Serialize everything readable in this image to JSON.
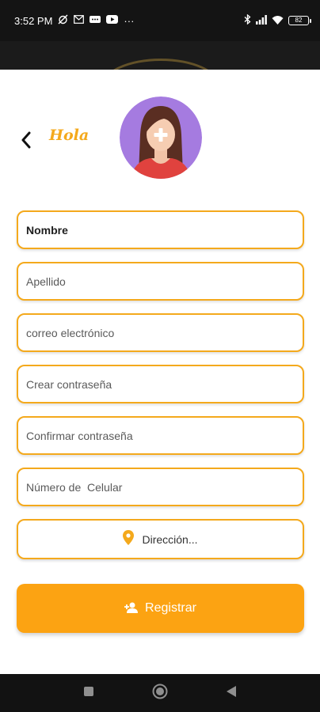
{
  "status_bar": {
    "time": "3:52 PM",
    "more_indicator": "···",
    "battery_level": "82"
  },
  "header": {
    "greeting": "Hola"
  },
  "form": {
    "nombre_value": "Nombre",
    "apellido_placeholder": "Apellido",
    "correo_placeholder": "correo electrónico",
    "password_placeholder": "Crear contraseña",
    "confirm_placeholder": "Confirmar contraseña",
    "phone_placeholder": "Número de  Celular",
    "address_label": "Dirección...",
    "register_label": "Registrar"
  },
  "colors": {
    "accent": "#f4a91c",
    "button": "#fca312",
    "avatar_bg": "#a57be0"
  },
  "icons": {
    "back": "chevron-left-icon",
    "address": "location-pin-icon",
    "register": "add-user-icon",
    "avatar_add": "plus-icon"
  }
}
